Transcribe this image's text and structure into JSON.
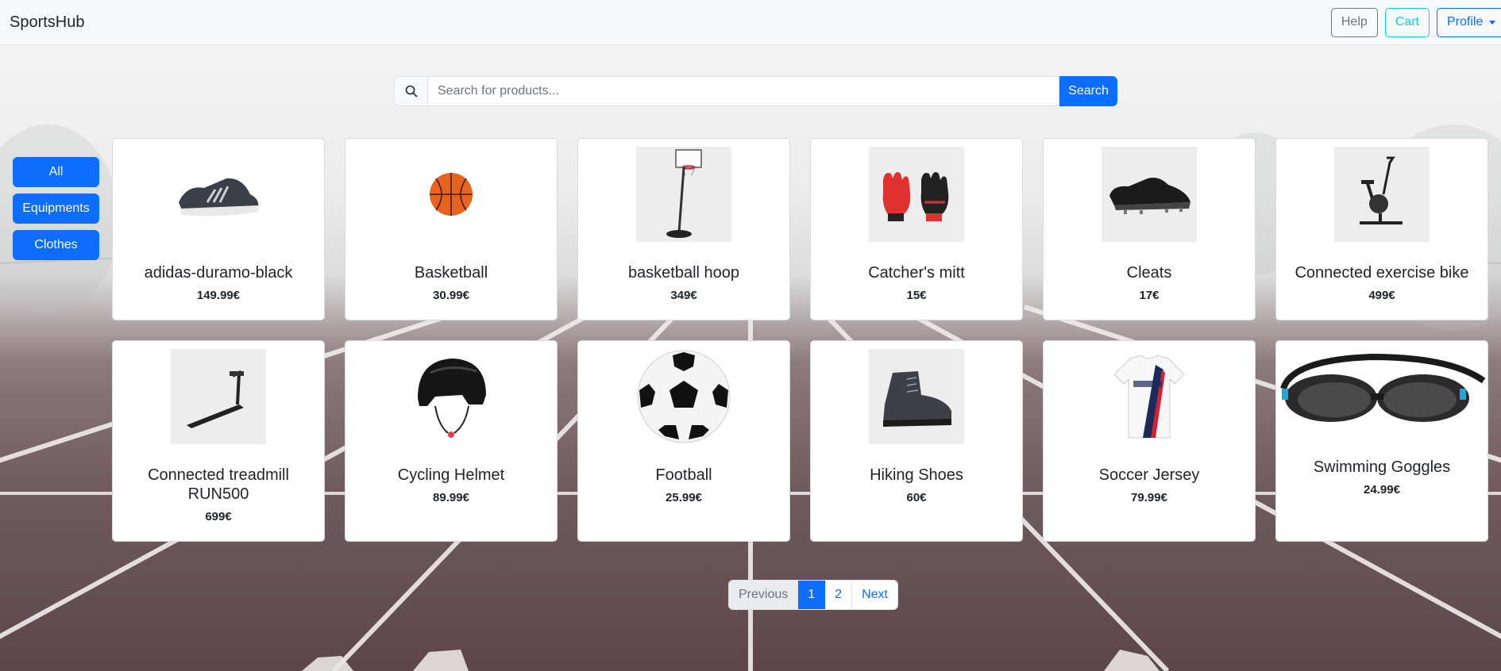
{
  "app": {
    "brand": "SportsHub"
  },
  "nav": {
    "help_label": "Help",
    "cart_label": "Cart",
    "profile_label": "Profile"
  },
  "search": {
    "placeholder": "Search for products...",
    "value": "",
    "button_label": "Search"
  },
  "categories": [
    "All",
    "Equipments",
    "Clothes"
  ],
  "products": [
    {
      "name": "adidas-duramo-black",
      "price": "149.99€",
      "icon": "running-shoe-image"
    },
    {
      "name": "Basketball",
      "price": "30.99€",
      "icon": "basketball-image"
    },
    {
      "name": "basketball hoop",
      "price": "349€",
      "icon": "basketball-hoop-image"
    },
    {
      "name": "Catcher's mitt",
      "price": "15€",
      "icon": "goalkeeper-gloves-image"
    },
    {
      "name": "Cleats",
      "price": "17€",
      "icon": "cleats-image"
    },
    {
      "name": "Connected exercise bike",
      "price": "499€",
      "icon": "exercise-bike-image"
    },
    {
      "name": "Connected treadmill RUN500",
      "price": "699€",
      "icon": "treadmill-image"
    },
    {
      "name": "Cycling Helmet",
      "price": "89.99€",
      "icon": "helmet-image"
    },
    {
      "name": "Football",
      "price": "25.99€",
      "icon": "soccer-ball-image"
    },
    {
      "name": "Hiking Shoes",
      "price": "60€",
      "icon": "hiking-shoe-image"
    },
    {
      "name": "Soccer Jersey",
      "price": "79.99€",
      "icon": "jersey-image"
    },
    {
      "name": "Swimming Goggles",
      "price": "24.99€",
      "icon": "goggles-image"
    }
  ],
  "pagination": {
    "previous_label": "Previous",
    "pages": [
      "1",
      "2"
    ],
    "current": "1",
    "next_label": "Next"
  },
  "colors": {
    "primary": "#0d6efd",
    "info": "#0dcaf0",
    "secondary": "#6c757d",
    "navbar_bg": "#f8f9fa",
    "track": "#6f5b5e"
  }
}
